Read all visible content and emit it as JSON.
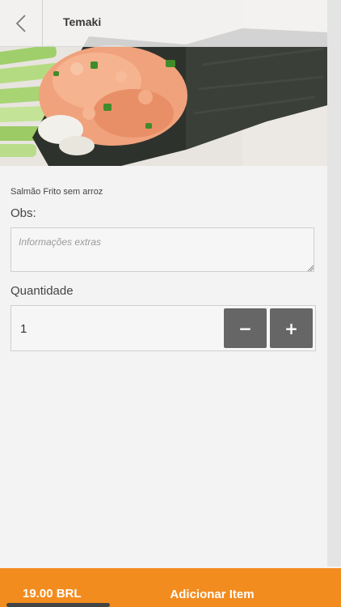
{
  "header": {
    "title": "Temaki",
    "back_icon": "chevron-left-icon"
  },
  "product": {
    "image": "temaki-photo",
    "description": "Salmão Frito sem arroz"
  },
  "obs": {
    "label": "Obs:",
    "placeholder": "Informações extras",
    "value": ""
  },
  "quantity": {
    "label": "Quantidade",
    "value": "1",
    "minus_label": "−",
    "plus_label": "+"
  },
  "footer": {
    "price": "19.00 BRL",
    "add_label": "Adicionar Item"
  },
  "colors": {
    "accent": "#f28c1f",
    "button": "#666666",
    "background": "#f3f3f3"
  }
}
